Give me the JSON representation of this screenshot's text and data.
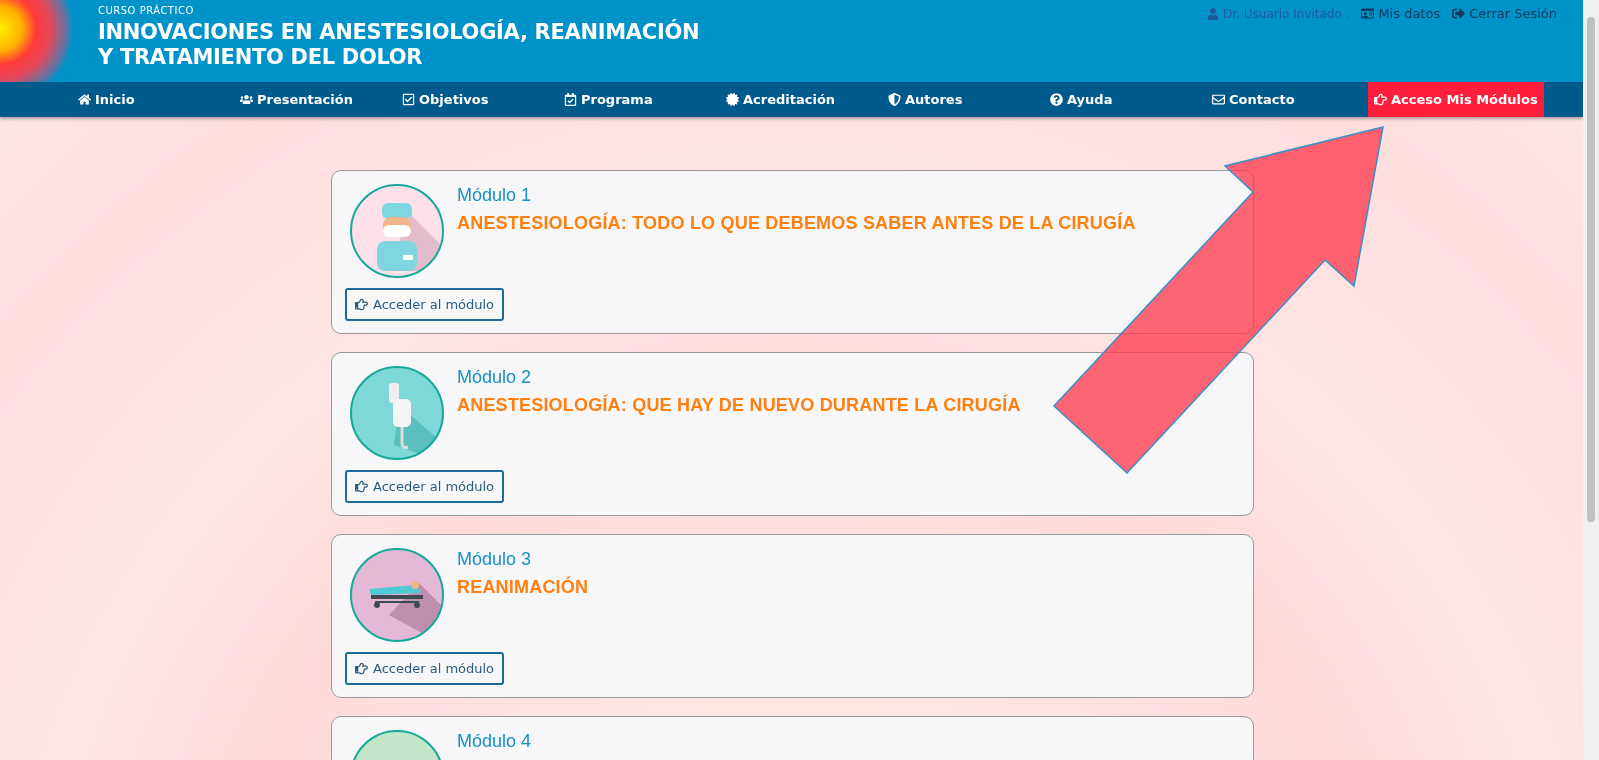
{
  "header": {
    "kicker": "CURSO PRÁCTICO",
    "title_line_1": "INNOVACIONES EN ANESTESIOLOGÍA, REANIMACIÓN",
    "title_line_2": "Y TRATAMIENTO DEL DOLOR"
  },
  "user_links": [
    {
      "kind": "user",
      "label": "Dr. Usuario Invitado ."
    },
    {
      "kind": "profile",
      "label": "Mis datos"
    },
    {
      "kind": "logout",
      "label": "Cerrar Sesión"
    }
  ],
  "nav": [
    {
      "kind": "home",
      "label": "Inicio",
      "selected": false
    },
    {
      "kind": "users",
      "label": "Presentación",
      "selected": false
    },
    {
      "kind": "check",
      "label": "Objetivos",
      "selected": false
    },
    {
      "kind": "calendar",
      "label": "Programa",
      "selected": false
    },
    {
      "kind": "certificate",
      "label": "Acreditación",
      "selected": false
    },
    {
      "kind": "shield",
      "label": "Autores",
      "selected": false
    },
    {
      "kind": "question",
      "label": "Ayuda",
      "selected": false
    },
    {
      "kind": "mail",
      "label": "Contacto",
      "selected": false
    },
    {
      "kind": "hand",
      "label": "Acceso Mis Módulos",
      "selected": true
    }
  ],
  "modules": [
    {
      "kind": "surgeon",
      "number": "Módulo 1",
      "title": "ANESTESIOLOGÍA: TODO LO QUE DEBEMOS SABER ANTES DE LA CIRUGÍA",
      "button": "Acceder al módulo"
    },
    {
      "kind": "drip",
      "number": "Módulo 2",
      "title": "ANESTESIOLOGÍA: QUE HAY DE NUEVO DURANTE LA CIRUGÍA",
      "button": "Acceder al módulo"
    },
    {
      "kind": "stretcher",
      "number": "Módulo 3",
      "title": "REANIMACIÓN",
      "button": "Acceder al módulo"
    },
    {
      "kind": "folder",
      "number": "Módulo 4"
    }
  ]
}
